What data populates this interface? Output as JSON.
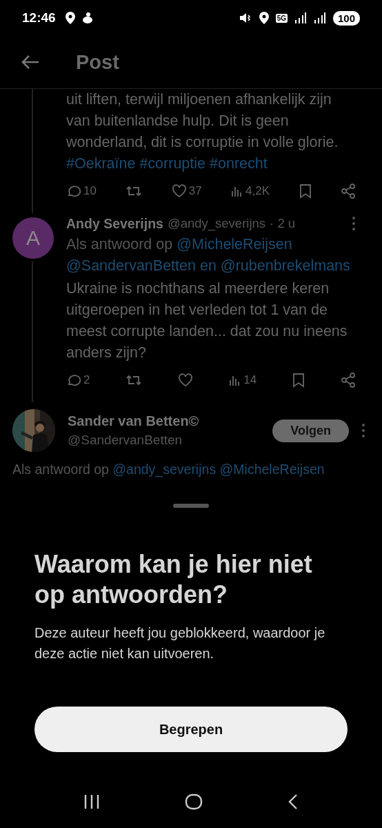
{
  "status_bar": {
    "time": "12:46",
    "network": "5G",
    "battery": "100"
  },
  "header": {
    "title": "Post"
  },
  "parent_post": {
    "text": "uit liften, terwijl miljoenen afhankelijk zijn van buitenlandse hulp. Dit is geen wonderland, dit is corruptie in volle glorie.",
    "hashtags": [
      "#Oekraïne",
      "#corruptie",
      "#onrecht"
    ],
    "stats": {
      "replies": "10",
      "likes": "37",
      "views": "4,2K"
    }
  },
  "reply": {
    "avatar_letter": "A",
    "color": "#5a2a66",
    "name": "Andy Severijns",
    "handle": "@andy_severijns",
    "time": "· 2 u",
    "reply_label": "Als antwoord op",
    "mentions": [
      "@MicheleReijsen",
      "@SandervanBetten en",
      "@rubenbrekelmans"
    ],
    "text": "Ukraine is nochthans al meerdere keren uitgeroepen in het verleden tot 1 van de meest corrupte landen... dat zou nu ineens anders zijn?",
    "stats": {
      "replies": "2",
      "views": "14"
    }
  },
  "author": {
    "avatar": {
      "kind": "picture"
    },
    "name": "Sander van Betten©",
    "handle": "@SandervanBetten",
    "follow_label": "Volgen",
    "reply_label": "Als antwoord op",
    "mentions": [
      "@andy_severijns",
      "@MicheleReijsen"
    ]
  },
  "sheet": {
    "title": "Waarom kan je hier niet op antwoorden?",
    "message": "Deze auteur heeft jou geblokkeerd, waardoor je deze actie niet kan uitvoeren.",
    "button": "Begrepen"
  }
}
